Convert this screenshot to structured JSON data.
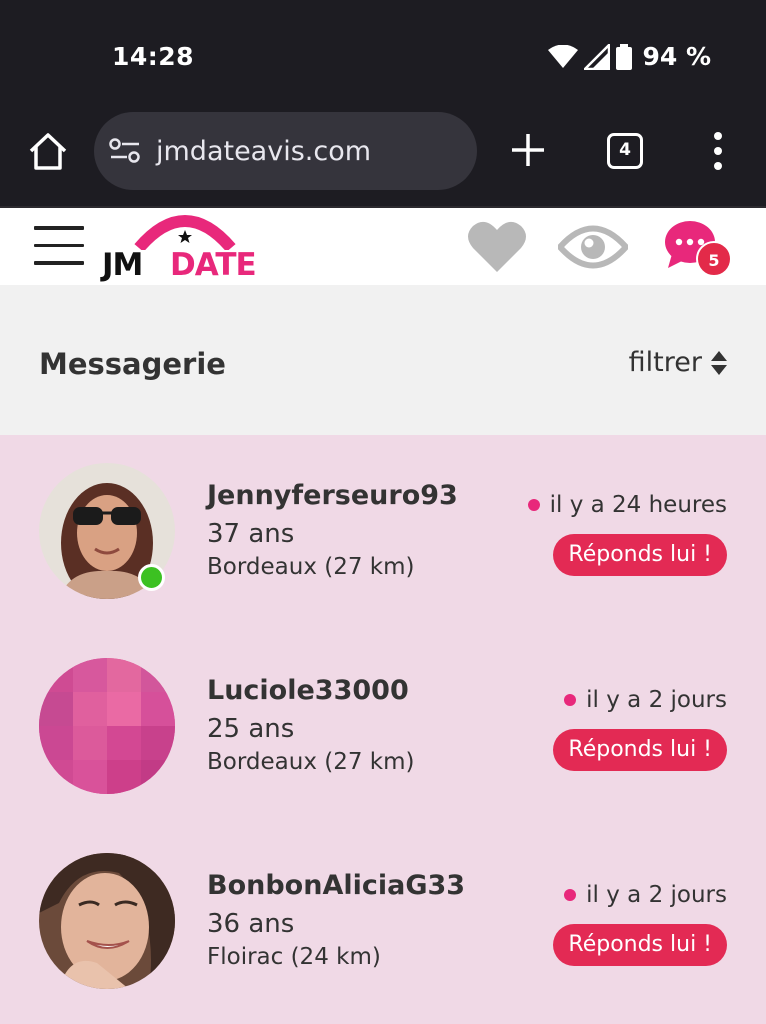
{
  "status_bar": {
    "time": "14:28",
    "battery": "94 %",
    "icons": [
      "wifi-icon",
      "signal-icon",
      "battery-icon"
    ]
  },
  "browser": {
    "url": "jmdateavis.com",
    "tab_count": "4",
    "icons": [
      "home-icon",
      "site-settings-icon",
      "new-tab-icon",
      "tabs-icon",
      "more-vert-icon"
    ]
  },
  "header": {
    "logo_jm": "JM",
    "logo_date": "DATE",
    "message_badge": "5",
    "icons": [
      "menu-icon",
      "heart-icon",
      "eye-icon",
      "chat-icon"
    ],
    "colors": {
      "brand_pink": "#e8287b",
      "badge_red": "#e32a49"
    }
  },
  "page": {
    "title": "Messagerie",
    "filter_label": "filtrer"
  },
  "conversations": [
    {
      "name": "Jennyferseuro93",
      "age": "37 ans",
      "city": "Bordeaux (27 km)",
      "time": "il y a 24 heures",
      "reply_label": "Réponds lui !",
      "online": true
    },
    {
      "name": "Luciole33000",
      "age": "25 ans",
      "city": "Bordeaux (27 km)",
      "time": "il y a 2 jours",
      "reply_label": "Réponds lui !",
      "online": false
    },
    {
      "name": "BonbonAliciaG33",
      "age": "36 ans",
      "city": "Floirac (24 km)",
      "time": "il y a 2 jours",
      "reply_label": "Réponds lui !",
      "online": false
    }
  ]
}
